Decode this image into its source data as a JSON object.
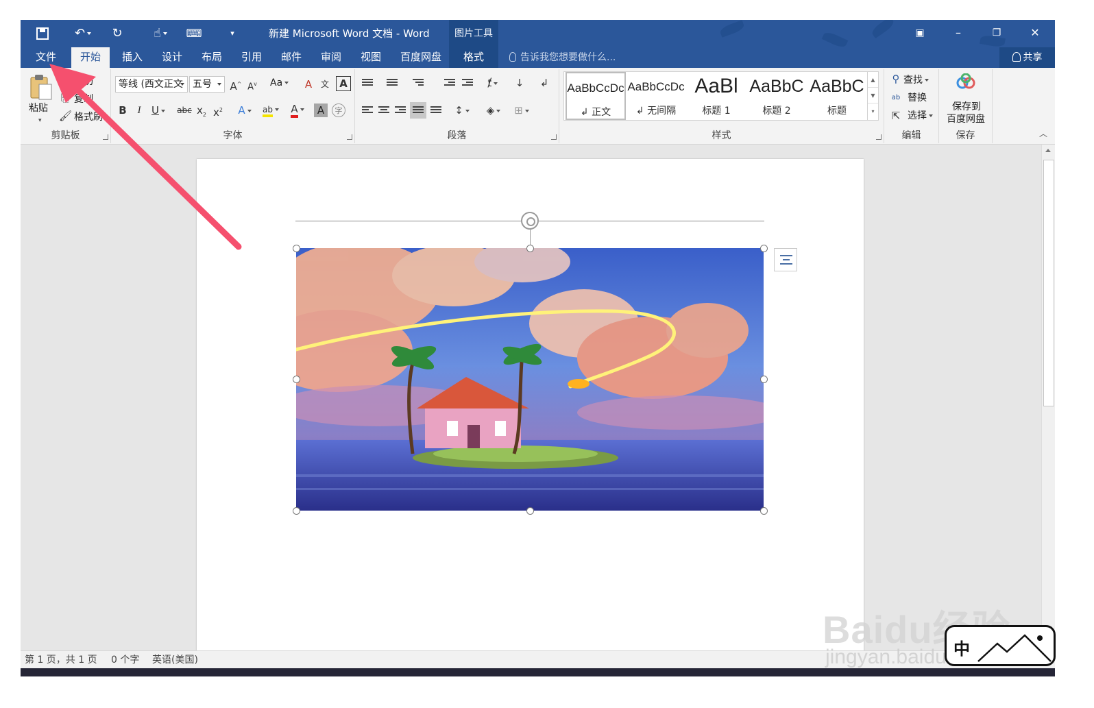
{
  "titlebar": {
    "title": "新建 Microsoft Word 文档 - Word",
    "context_tools": "图片工具"
  },
  "tabs": {
    "file": "文件",
    "home": "开始",
    "insert": "插入",
    "design": "设计",
    "layout": "布局",
    "references": "引用",
    "mailings": "邮件",
    "review": "审阅",
    "view": "视图",
    "baidu": "百度网盘",
    "format": "格式",
    "tell_me": "告诉我您想要做什么...",
    "share": "共享"
  },
  "ribbon": {
    "clipboard": {
      "paste": "粘贴",
      "cut": "剪切",
      "copy": "复制",
      "format_painter": "格式刷",
      "label": "剪贴板"
    },
    "font": {
      "name": "等线 (西文正文",
      "size": "五号",
      "case": "Aa",
      "label": "字体"
    },
    "paragraph": {
      "label": "段落"
    },
    "styles": {
      "label": "样式",
      "items": [
        {
          "sample": "AaBbCcDc",
          "name": "↲ 正文"
        },
        {
          "sample": "AaBbCcDc",
          "name": "↲ 无间隔"
        },
        {
          "sample": "AaBl",
          "name": "标题 1"
        },
        {
          "sample": "AaBbC",
          "name": "标题 2"
        },
        {
          "sample": "AaBbC",
          "name": "标题"
        }
      ]
    },
    "editing": {
      "find": "查找",
      "replace": "替换",
      "select": "选择",
      "label": "编辑"
    },
    "save": {
      "line1": "保存到",
      "line2": "百度网盘",
      "label": "保存"
    }
  },
  "statusbar": {
    "page": "第 1 页，共 1 页",
    "words": "0 个字",
    "language": "英语(美国)"
  },
  "watermark": {
    "brand": "Baidu经验",
    "url": "jingyan.baidu.com",
    "badge": "中"
  },
  "colors": {
    "word_blue": "#2b579a",
    "annotation_arrow": "#f5506e"
  }
}
